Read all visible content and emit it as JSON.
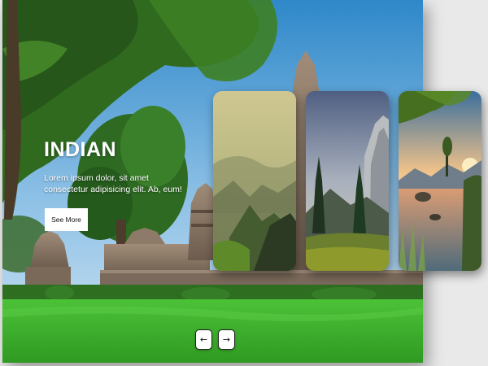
{
  "hero": {
    "title": "INDIAN",
    "description": "Lorem ipsum dolor, sit amet consectetur adipisicing elit. Ab, eum!",
    "button_label": "See More"
  },
  "cards": [
    {
      "scene": "misty-mountain-valley"
    },
    {
      "scene": "cliff-and-pine-meadow"
    },
    {
      "scene": "sunset-lake-with-tree"
    }
  ],
  "nav": {
    "prev_icon": "arrow-left-icon",
    "prev_glyph": "←",
    "next_icon": "arrow-right-icon",
    "next_glyph": "→"
  },
  "colors": {
    "sky_top": "#2f88c9",
    "grass": "#3fb52e",
    "tree": "#2f6a1e",
    "temple": "#8a7868",
    "button_bg": "#ffffff"
  }
}
